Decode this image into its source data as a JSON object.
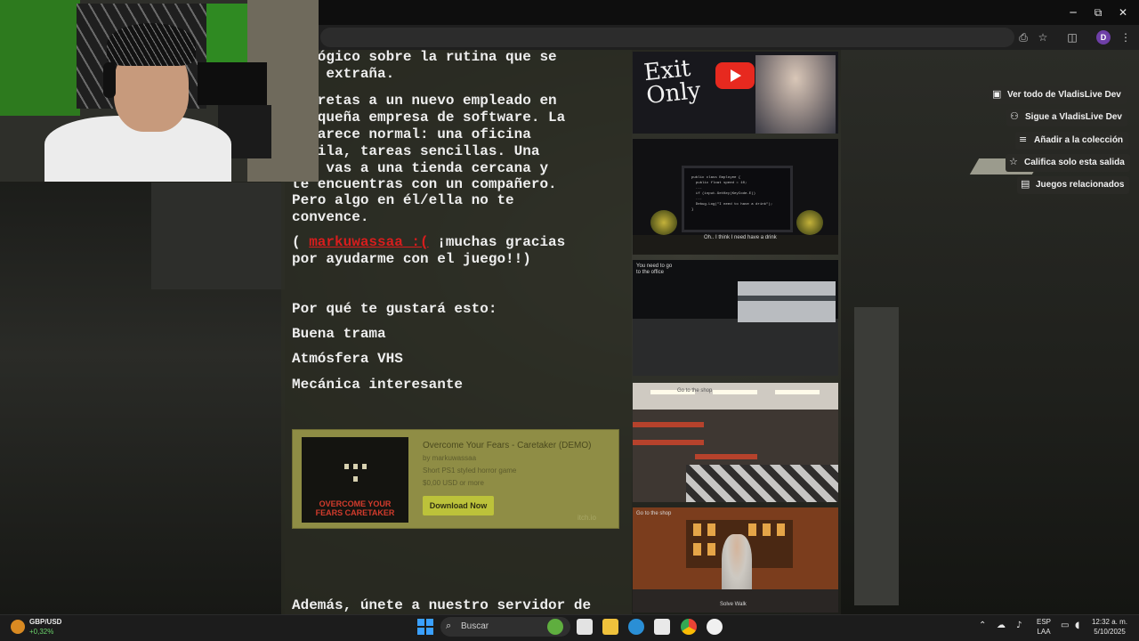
{
  "browser": {
    "window_controls": {
      "minimize": "─",
      "maximize": "⧉",
      "close": "✕"
    },
    "profile_initial": "D"
  },
  "description": {
    "lines": [
      "cológico sobre la rutina que se",
      "lve extraña.",
      "erpretas a un nuevo empleado en",
      " pequeña empresa de software. La",
      "a parece normal: una oficina",
      "nquila, tareas sencillas. Una",
      "he, vas a una tienda cercana y",
      "te encuentras con un compañero.",
      "Pero algo en él/ella no te",
      "convence."
    ],
    "credit_open": "( ",
    "credit_link": "markuwassaa :(",
    "credit_after": " ¡muchas gracias",
    "credit_line2": "por ayudarme con el juego!!)",
    "why_heading": "Por qué te gustará esto:",
    "features": [
      "Buena trama",
      "Atmósfera VHS",
      "Mecánica interesante"
    ],
    "footer": "Además, únete a nuestro servidor de"
  },
  "widget": {
    "title": "Overcome Your Fears - Caretaker (DEMO)",
    "by": "by markuwassaa",
    "short": "Short PS1 styled horror game",
    "price": "$0,00 USD or more",
    "button": "Download Now",
    "brand": "itch.io",
    "thumb_text": "OVERCOME YOUR FEARS\nCARETAKER"
  },
  "screenshots": {
    "s1_text": "Exit\nOnly",
    "s2_code": "public class Employee {\n  public float speed = 10;\n  ...\n  if (input.GetKey(KeyCode.E))\n  ...\n  Debug.Log(\"I need to have a drink\");\n}",
    "s2_caption": "Oh.. I think I need have a drink",
    "s3_caption": "You need to go\nto the office",
    "s4_caption": "Go to the shop",
    "s5_caption": "Go to the shop",
    "s5_sub": "Solve Walk"
  },
  "side_buttons": [
    {
      "icon": "itch",
      "label": "Ver todo de VladisLive Dev"
    },
    {
      "icon": "follow",
      "label": "Sigue a VladisLive Dev"
    },
    {
      "icon": "add",
      "label": "Añadir a la colección"
    },
    {
      "icon": "star",
      "label": "Califica solo esta salida"
    },
    {
      "icon": "map",
      "label": "Juegos relacionados"
    }
  ],
  "taskbar": {
    "ticker_name": "GBP/USD",
    "ticker_change": "+0,32%",
    "search_placeholder": "Buscar",
    "lang_top": "ESP",
    "lang_bottom": "LAA",
    "time": "12:32 a. m.",
    "date": "5/10/2025",
    "colors": {
      "accent": "#3aa0ff",
      "ticker_up": "#6bd36b"
    }
  }
}
